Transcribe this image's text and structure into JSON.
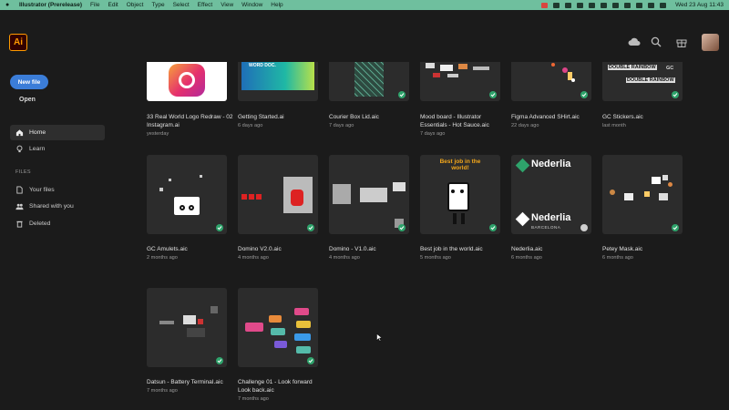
{
  "menubar": {
    "app": "Illustrator (Prerelease)",
    "items": [
      "File",
      "Edit",
      "Object",
      "Type",
      "Select",
      "Effect",
      "View",
      "Window",
      "Help"
    ],
    "clock": "Wed 23 Aug  11:43"
  },
  "header": {
    "logo": "Ai",
    "icons": [
      "cloud-icon",
      "search-icon",
      "gift-icon"
    ]
  },
  "sidebar": {
    "new_file": "New file",
    "open": "Open",
    "nav": [
      {
        "label": "Home",
        "icon": "home-icon"
      },
      {
        "label": "Learn",
        "icon": "lightbulb-icon"
      }
    ],
    "files_label": "FILES",
    "files": [
      {
        "label": "Your files",
        "icon": "document-icon"
      },
      {
        "label": "Shared with you",
        "icon": "people-icon"
      },
      {
        "label": "Deleted",
        "icon": "trash-icon"
      }
    ]
  },
  "files": [
    {
      "name": "33 Real World Logo Redraw - 02 Instagram.ai",
      "date": "yesterday",
      "synced": false
    },
    {
      "name": "Getting Started.ai",
      "date": "6 days ago",
      "synced": false
    },
    {
      "name": "Courier Box Lid.aic",
      "date": "7 days ago",
      "synced": true
    },
    {
      "name": "Mood board - Illustrator Essentials - Hot Sauce.aic",
      "date": "7 days ago",
      "synced": true
    },
    {
      "name": "Figma Advanced SHirt.aic",
      "date": "22 days ago",
      "synced": true
    },
    {
      "name": "GC Stickers.aic",
      "date": "last month",
      "synced": true
    },
    {
      "name": "GC Amulets.aic",
      "date": "2 months ago",
      "synced": true
    },
    {
      "name": "Domino V2.0.aic",
      "date": "4 months ago",
      "synced": true
    },
    {
      "name": "Domino - V1.0.aic",
      "date": "4 months ago",
      "synced": true
    },
    {
      "name": "Best job in the world.aic",
      "date": "5 months ago",
      "synced": true
    },
    {
      "name": "Nederlia.aic",
      "date": "6 months ago",
      "synced": true
    },
    {
      "name": "Petey Mask.aic",
      "date": "6 months ago",
      "synced": true
    },
    {
      "name": "Datsun - Battery TerminaI.aic",
      "date": "7 months ago",
      "synced": true
    },
    {
      "name": "Challenge 01 - Look forward Look back.aic",
      "date": "7 months ago",
      "synced": true
    }
  ],
  "thumb_text": {
    "getting_started": "WORD DOC.",
    "double_rainbow_1": "DOUBLE RAINBOW",
    "double_rainbow_2": "DOUBLE RAINBOW",
    "gc": "GC",
    "best_job": "Best job in the world!",
    "nederlia_top": "Nederlia",
    "nederlia_bottom": "Nederlia",
    "barcelona": "BARCELONA"
  },
  "colors": {
    "menubar": "#6fbf9e",
    "accent": "#3b7dd8",
    "sync": "#2ea36b",
    "ai_orange": "#ff9a00"
  }
}
